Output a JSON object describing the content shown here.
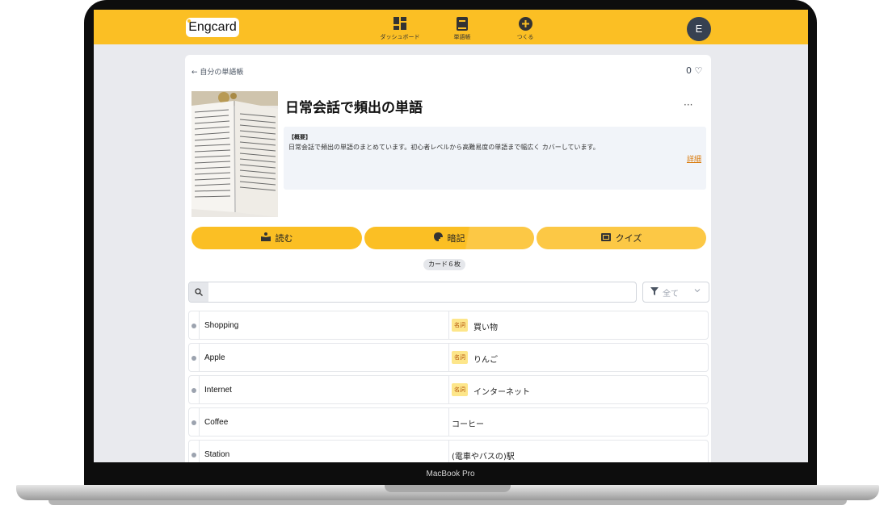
{
  "device": {
    "label": "MacBook Pro"
  },
  "header": {
    "logo": "Engcard",
    "nav": [
      {
        "label": "ダッシュボード",
        "icon": "dashboard-icon"
      },
      {
        "label": "単語帳",
        "icon": "book-icon"
      },
      {
        "label": "つくる",
        "icon": "plus-circle-icon"
      }
    ],
    "avatar": "E"
  },
  "deck": {
    "back_label": "自分の単語帳",
    "likes": "0",
    "title": "日常会話で頻出の単語",
    "summary_heading": "【概要】",
    "summary_text": "日常会話で頻出の単語のまとめています。初心者レベルから高難易度の単語まで幅広く カバーしています。",
    "detail_link": "詳細",
    "more_label": "···"
  },
  "actions": [
    {
      "label": "読む",
      "icon": "reading-icon"
    },
    {
      "label": "暗記",
      "icon": "brain-icon"
    },
    {
      "label": "クイズ",
      "icon": "quiz-book-icon"
    }
  ],
  "card_count": "カード６枚",
  "search": {
    "placeholder": ""
  },
  "filter": {
    "label": "全て"
  },
  "cards": [
    {
      "word": "Shopping",
      "pos": "名詞",
      "meaning": "買い物"
    },
    {
      "word": "Apple",
      "pos": "名詞",
      "meaning": "りんご"
    },
    {
      "word": "Internet",
      "pos": "名詞",
      "meaning": "インターネット"
    },
    {
      "word": "Coffee",
      "pos": "",
      "meaning": "コーヒー"
    },
    {
      "word": "Station",
      "pos": "",
      "meaning": "(電車やバスの)駅"
    }
  ],
  "colors": {
    "accent": "#fbbf24",
    "background": "#e9eaee"
  }
}
